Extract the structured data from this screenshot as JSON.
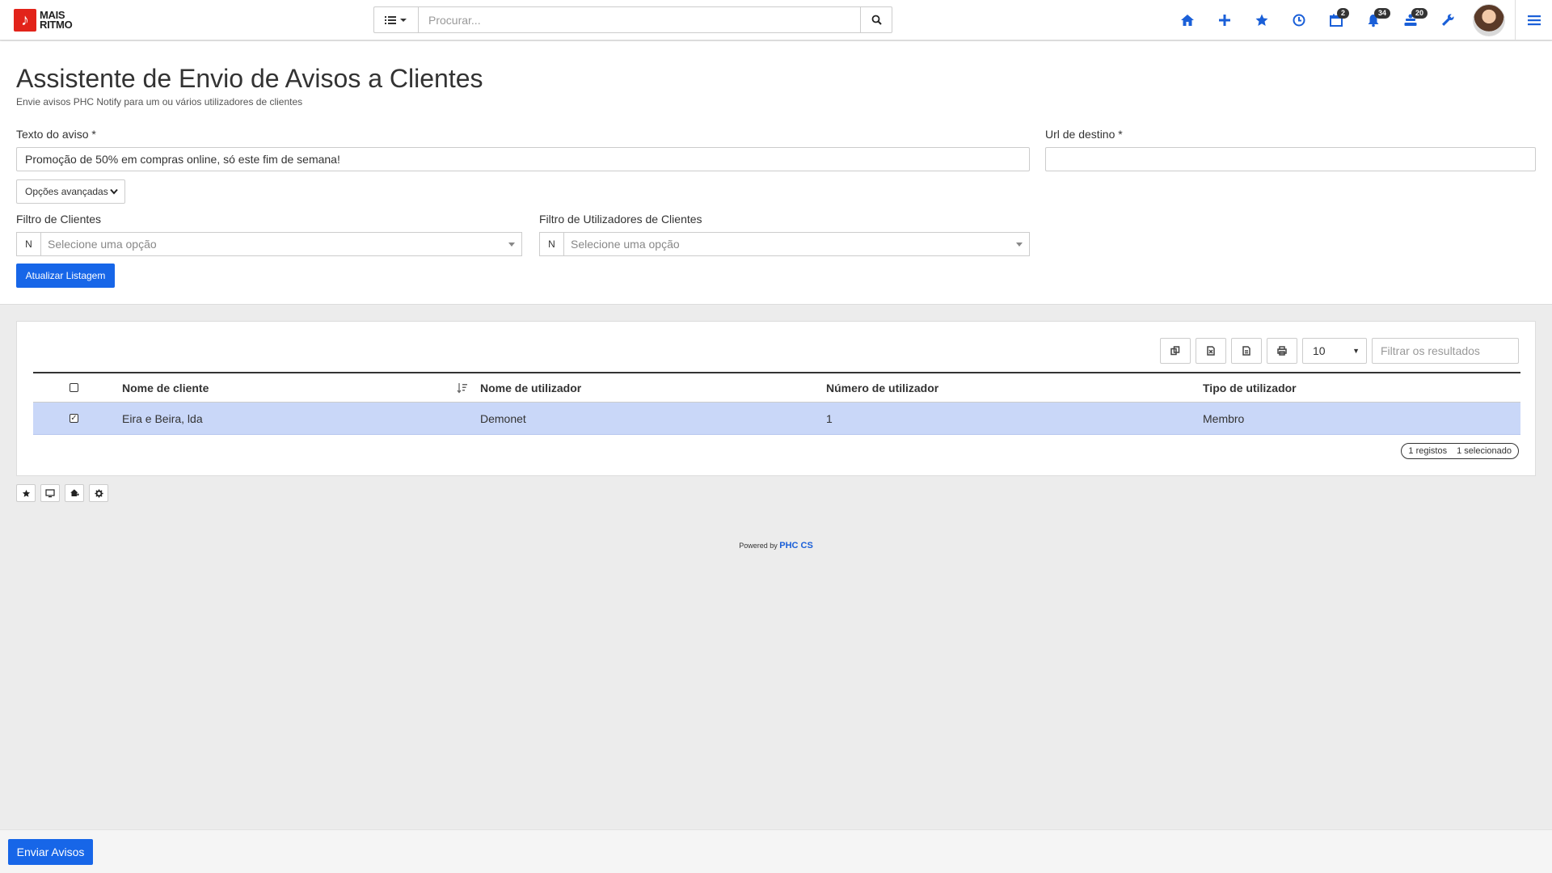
{
  "app": {
    "logo_line1": "MAIS",
    "logo_line2": "RITMO",
    "logo_mark": "♪"
  },
  "search": {
    "placeholder": "Procurar...",
    "menu_icon": "list-icon",
    "button_icon": "search-icon"
  },
  "topnav": {
    "icons": [
      "home-icon",
      "plus-icon",
      "star-icon",
      "clock-icon",
      "calendar-icon",
      "bell-icon",
      "users-icon",
      "wrench-icon"
    ],
    "calendar_badge": "2",
    "bell_badge": "34",
    "users_badge": "20",
    "accent": "#1a5fd8"
  },
  "page": {
    "title": "Assistente de Envio de Avisos a Clientes",
    "subtitle": "Envie avisos PHC Notify para um ou vários utilizadores de clientes"
  },
  "form": {
    "message_label": "Texto do aviso *",
    "message_value": "Promoção de 50% em compras online, só este fim de semana!",
    "url_label": "Url de destino *",
    "url_value": "",
    "advanced_label": "Opções avançadas",
    "client_filter_label": "Filtro de Clientes",
    "client_filter_prefix": "N",
    "client_filter_placeholder": "Selecione uma opção",
    "user_filter_label": "Filtro de Utilizadores de Clientes",
    "user_filter_prefix": "N",
    "user_filter_placeholder": "Selecione uma opção",
    "refresh_label": "Atualizar Listagem"
  },
  "table": {
    "page_size": "10",
    "filter_placeholder": "Filtrar os resultados",
    "tool_icons": [
      "copy-icon",
      "excel-icon",
      "pdf-icon",
      "print-icon"
    ],
    "columns": [
      "Nome de cliente",
      "Nome de utilizador",
      "Número de utilizador",
      "Tipo de utilizador"
    ],
    "rows": [
      {
        "checked": true,
        "cells": [
          "Eira e Beira, lda",
          "Demonet",
          "1",
          "Membro"
        ]
      }
    ],
    "summary_count": "1 registos",
    "summary_selected": "1 selecionado",
    "selected_row_color": "#c9d7f8"
  },
  "bottom_icons": [
    "star-icon",
    "monitor-icon",
    "home-add-icon",
    "gear-icon"
  ],
  "powered": {
    "prefix": "Powered by",
    "brand": "PHC CS"
  },
  "footer": {
    "send_label": "Enviar Avisos"
  }
}
